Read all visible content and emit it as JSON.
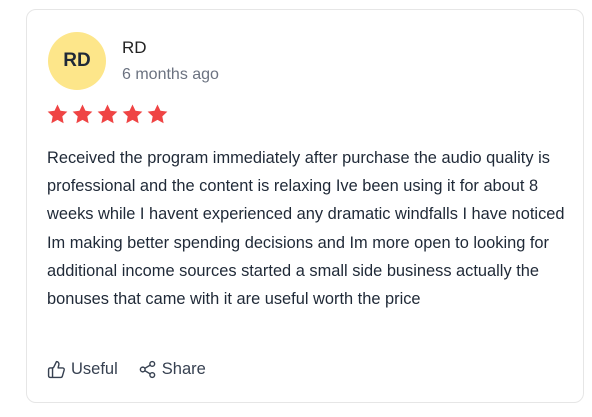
{
  "review": {
    "avatar_initials": "RD",
    "avatar_color": "#fde68a",
    "author": "RD",
    "time_ago": "6 months ago",
    "rating": 5,
    "rating_max": 5,
    "star_color": "#ef4444",
    "text": "Received the program immediately after purchase the audio quality is professional and the content is relaxing Ive been using it for about 8 weeks while I havent experienced any dramatic windfalls I have noticed Im making better spending decisions and Im more open to looking for additional income sources started a small side business actually the bonuses that came with it are useful worth the price"
  },
  "actions": {
    "useful_label": "Useful",
    "useful_icon": "thumbs-up-icon",
    "share_label": "Share",
    "share_icon": "share-icon"
  }
}
